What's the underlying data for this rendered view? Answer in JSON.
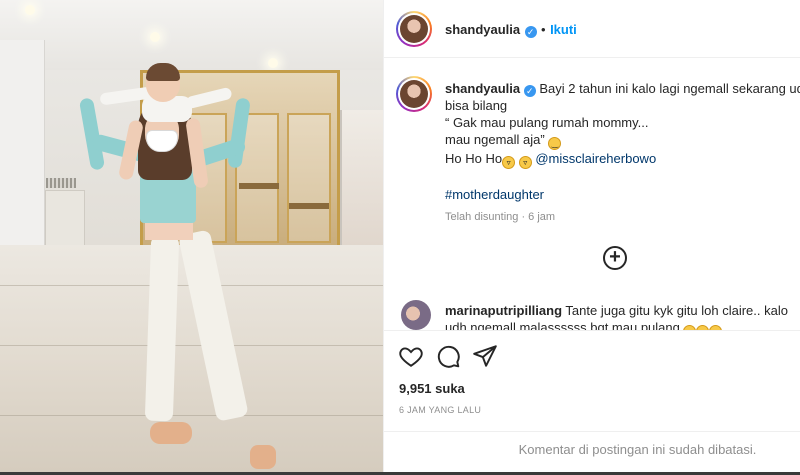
{
  "post": {
    "author": "shandyaulia",
    "follow_label": "Ikuti",
    "dot": "•",
    "caption_lines": [
      "Bayi 2 tahun ini kalo lagi ngemall sekarang uda",
      "bisa bilang",
      "“ Gak mau pulang rumah mommy...",
      "mau ngemall aja”"
    ],
    "caption_last_prefix": "Ho Ho Ho",
    "mention": "@missclaireherbowo",
    "hashtag": "#motherdaughter",
    "edited": "Telah disunting · 6 jam",
    "more_comments_icon": "plus-circle-icon"
  },
  "comment": {
    "author": "marinaputripilliang",
    "text": "Tante juga gitu kyk gitu loh claire.. kalo udh ngemall malassssss bgt mau pulang"
  },
  "actions": {
    "likes": "9,951 suka",
    "time_ago": "6 JAM YANG LALU",
    "comments_closed": "Komentar di postingan ini sudah dibatasi."
  },
  "colors": {
    "link": "#00376b",
    "follow": "#0095f6",
    "verified": "#3897f0",
    "muted": "#8e8e8e"
  }
}
